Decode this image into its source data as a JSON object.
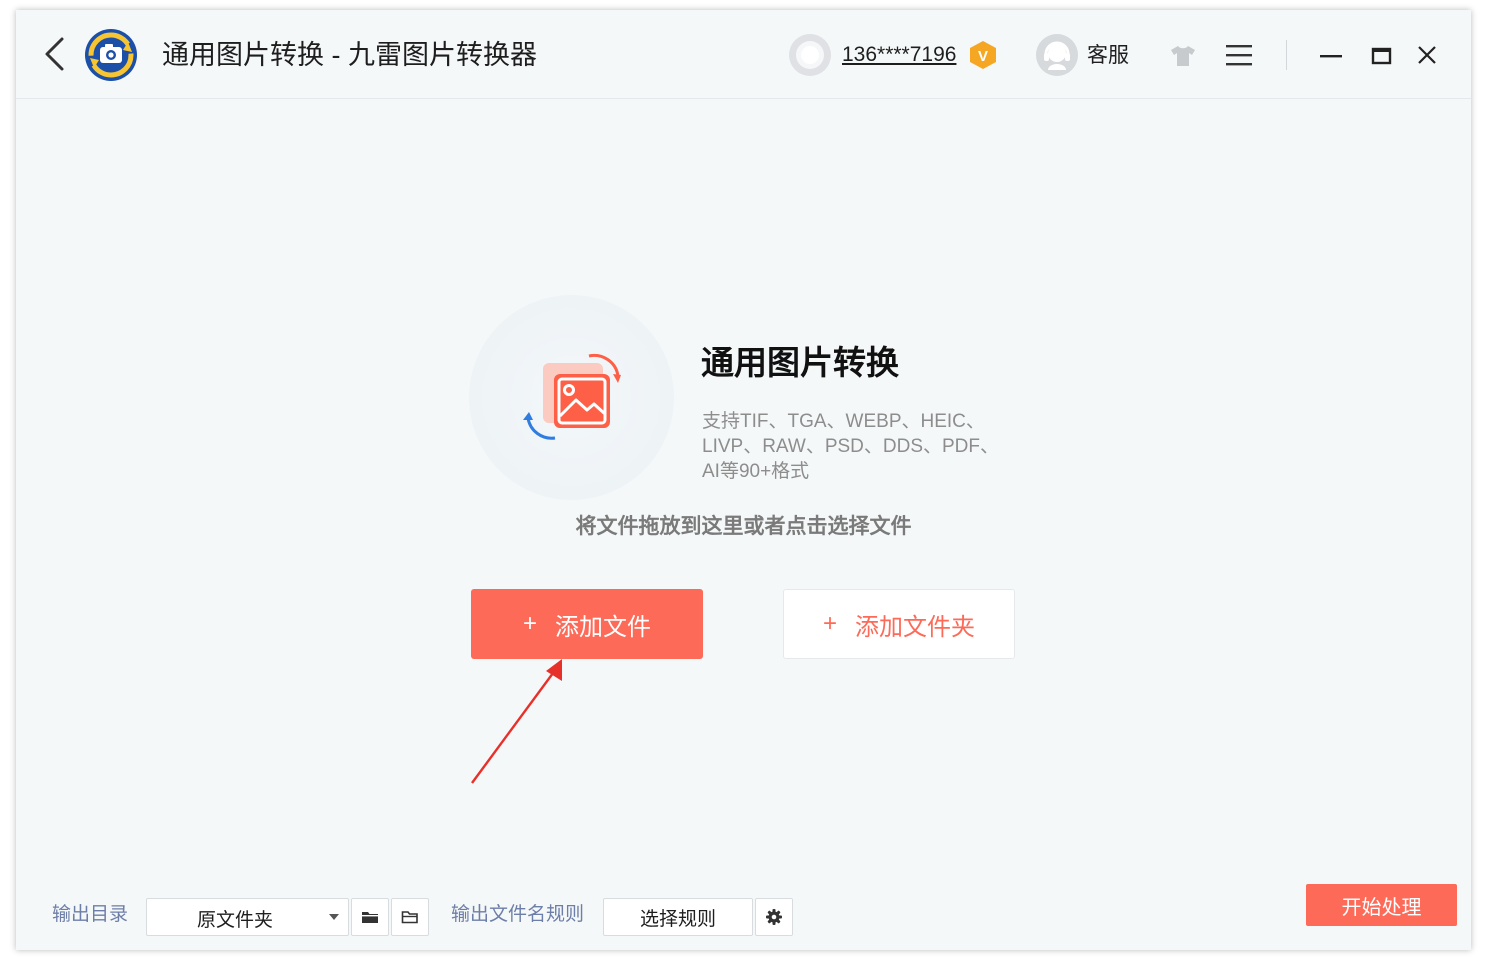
{
  "titlebar": {
    "app_title": "通用图片转换 - 九雷图片转换器",
    "user_id": "136****7196",
    "vip_badge": "V",
    "service_label": "客服"
  },
  "feature": {
    "title": "通用图片转换",
    "formats_line1": "支持TIF、TGA、WEBP、HEIC、",
    "formats_line2": "LIVP、RAW、PSD、DDS、PDF、",
    "formats_line3": "AI等90+格式",
    "drop_hint": "将文件拖放到这里或者点击选择文件"
  },
  "actions": {
    "add_file_plus": "+",
    "add_file_label": "添加文件",
    "add_folder_plus": "+",
    "add_folder_label": "添加文件夹"
  },
  "bottom_bar": {
    "output_dir_label": "输出目录",
    "output_dir_value": "原文件夹",
    "filename_rule_label": "输出文件名规则",
    "select_rule_label": "选择规则",
    "start_label": "开始处理"
  },
  "colors": {
    "accent": "#fd6a58",
    "label_blue": "#6d7ea8",
    "vip_orange": "#f5a623",
    "annotation_red": "#e8302a"
  }
}
